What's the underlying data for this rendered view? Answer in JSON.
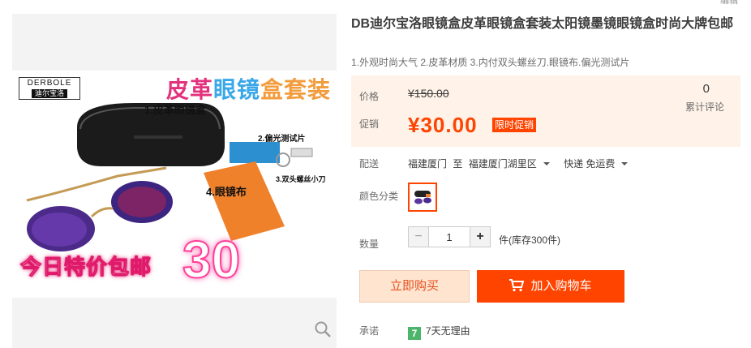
{
  "corner_text": "编辑",
  "gallery": {
    "brand_en": "DERBOLE",
    "brand_cn": "迪尔宝洛",
    "headline_a": "皮革",
    "headline_b": "眼镜",
    "headline_c": "盒套装",
    "callout_1": "1.皮革眼镜盒",
    "callout_2": "2.偏光测试片",
    "callout_3": "4.眼镜布",
    "callout_4": "3.双头螺丝小刀",
    "promo_text": "今日特价包邮",
    "promo_number": "30"
  },
  "product": {
    "title": "DB迪尔宝洛眼镜盒皮革眼镜盒套装太阳镜墨镜眼镜盒时尚大牌包邮",
    "subtitle": "1.外观时尚大气 2.皮革材质 3.内付双头螺丝刀.眼镜布.偏光测试片"
  },
  "price": {
    "price_label": "价格",
    "original_price": "¥150.00",
    "promo_label": "促销",
    "promo_price": "¥30.00",
    "promo_tag": "限时促销",
    "review_count": "0",
    "review_label": "累计评论"
  },
  "shipping": {
    "label": "配送",
    "from": "福建厦门",
    "to_word": "至",
    "dest": "福建厦门湖里区",
    "method": "快递 免运费"
  },
  "color": {
    "label": "颜色分类"
  },
  "quantity": {
    "label": "数量",
    "minus": "−",
    "value": "1",
    "plus": "+",
    "stock": "件(库存300件)"
  },
  "actions": {
    "buy_now": "立即购买",
    "add_to_cart": "加入购物车"
  },
  "promise": {
    "label": "承诺",
    "badge": "7",
    "text": "7天无理由"
  },
  "colors": {
    "accent": "#ff4400",
    "price_bg": "#fff2e8",
    "buy_bg": "#ffe4d0",
    "badge_green": "#4cb46b"
  }
}
